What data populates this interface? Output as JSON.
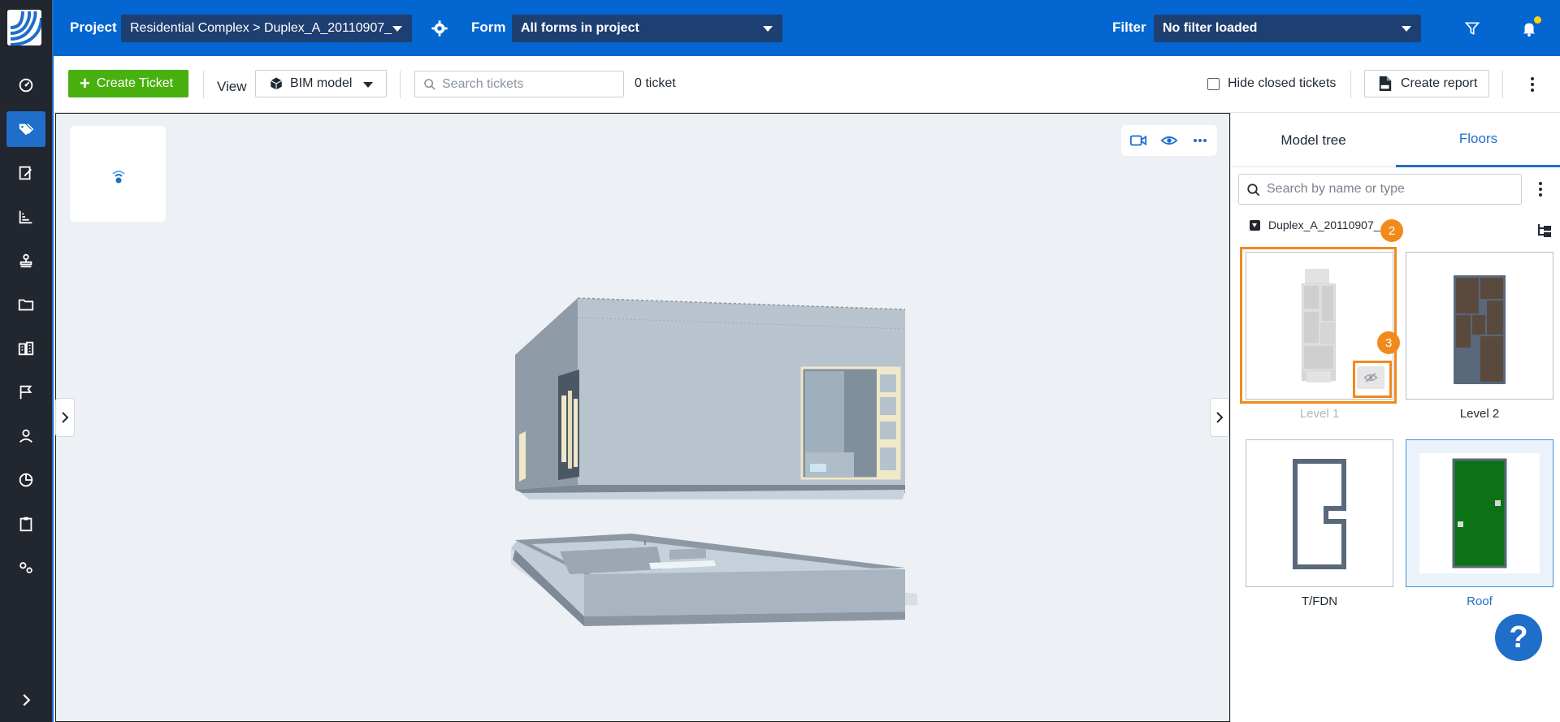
{
  "topbar": {
    "project_label": "Project",
    "project_value": "Residential Complex > Duplex_A_20110907_",
    "form_label": "Form",
    "form_value": "All forms in project",
    "filter_label": "Filter",
    "filter_value": "No filter loaded",
    "icons": [
      "settings-gear-icon",
      "filter-funnel-icon",
      "notification-bell-icon"
    ],
    "notification_dot_color": "#ffd200"
  },
  "toolbar": {
    "create_ticket_label": "Create Ticket",
    "view_label": "View",
    "view_value": "BIM model",
    "search_placeholder": "Search tickets",
    "search_value": "",
    "ticket_count": "0 ticket",
    "hide_closed_label": "Hide closed tickets",
    "hide_closed_checked": false,
    "create_report_label": "Create report"
  },
  "sidebar": {
    "items": [
      {
        "icon": "dashboard-gauge-icon",
        "active": false
      },
      {
        "icon": "tickets-tag-icon",
        "active": true
      },
      {
        "icon": "forms-edit-icon",
        "active": false
      },
      {
        "icon": "reports-chart-icon",
        "active": false
      },
      {
        "icon": "stamp-icon",
        "active": false
      },
      {
        "icon": "folder-icon",
        "active": false
      },
      {
        "icon": "buildings-icon",
        "active": false
      },
      {
        "icon": "flag-icon",
        "active": false
      },
      {
        "icon": "user-icon",
        "active": false
      },
      {
        "icon": "pie-chart-icon",
        "active": false
      },
      {
        "icon": "clipboard-icon",
        "active": false
      },
      {
        "icon": "settings-gears-icon",
        "active": false
      }
    ],
    "expand_icon": "chevron-right-icon"
  },
  "viewer": {
    "tools": [
      "camera-icon",
      "eye-icon",
      "more-dots-icon"
    ]
  },
  "panel": {
    "tabs": [
      {
        "label": "Model tree",
        "active": false
      },
      {
        "label": "Floors",
        "active": true
      }
    ],
    "search_placeholder": "Search by name or type",
    "search_value": "",
    "tree_root": "Duplex_A_20110907_",
    "floors": [
      {
        "label": "Level 1",
        "hidden": true,
        "highlighted": true
      },
      {
        "label": "Level 2",
        "hidden": false
      },
      {
        "label": "T/FDN",
        "hidden": false
      },
      {
        "label": "Roof",
        "hidden": false,
        "selected": true
      }
    ],
    "badges": [
      "2",
      "3"
    ],
    "help_label": "?",
    "highlight_color": "#f08a1c",
    "accent_color": "#1f6ec9"
  }
}
